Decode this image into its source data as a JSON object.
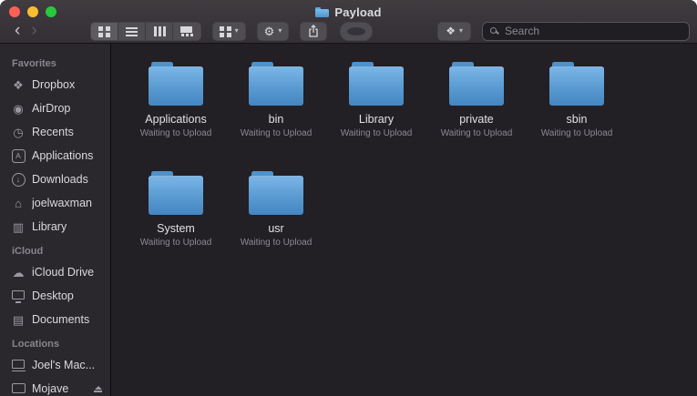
{
  "window": {
    "title": "Payload"
  },
  "traffic_lights": {
    "close": "#ff5f57",
    "minimize": "#fdbc2f",
    "zoom": "#28c83f"
  },
  "toolbar": {
    "back_glyph": "‹",
    "forward_glyph": "›",
    "chevron_down": "▾",
    "gear_glyph": "⚙",
    "dropbox_glyph": "❖",
    "view_modes": [
      "icon",
      "list",
      "column",
      "gallery"
    ],
    "search": {
      "placeholder": "Search"
    }
  },
  "sidebar": {
    "sections": [
      {
        "title": "Favorites",
        "items": [
          {
            "label": "Dropbox",
            "icon": "dropbox",
            "glyph": "❖"
          },
          {
            "label": "AirDrop",
            "icon": "airdrop",
            "glyph": "◉"
          },
          {
            "label": "Recents",
            "icon": "recents",
            "glyph": "◷"
          },
          {
            "label": "Applications",
            "icon": "applications"
          },
          {
            "label": "Downloads",
            "icon": "downloads"
          },
          {
            "label": "joelwaxman",
            "icon": "home",
            "glyph": "⌂"
          },
          {
            "label": "Library",
            "icon": "library",
            "glyph": "▥"
          }
        ]
      },
      {
        "title": "iCloud",
        "items": [
          {
            "label": "iCloud Drive",
            "icon": "cloud",
            "glyph": "☁"
          },
          {
            "label": "Desktop",
            "icon": "desktop"
          },
          {
            "label": "Documents",
            "icon": "documents",
            "glyph": "▤"
          }
        ]
      },
      {
        "title": "Locations",
        "items": [
          {
            "label": "Joel's Mac...",
            "icon": "laptop"
          },
          {
            "label": "Mojave",
            "icon": "disk",
            "eject": true
          }
        ]
      }
    ]
  },
  "content": {
    "folders": [
      {
        "name": "Applications",
        "status": "Waiting to Upload"
      },
      {
        "name": "bin",
        "status": "Waiting to Upload"
      },
      {
        "name": "Library",
        "status": "Waiting to Upload"
      },
      {
        "name": "private",
        "status": "Waiting to Upload"
      },
      {
        "name": "sbin",
        "status": "Waiting to Upload"
      },
      {
        "name": "System",
        "status": "Waiting to Upload"
      },
      {
        "name": "usr",
        "status": "Waiting to Upload"
      }
    ]
  },
  "colors": {
    "folder_blue": "#5697ce",
    "primary_text": "#dad9dc",
    "secondary_text": "#8c8b91"
  }
}
